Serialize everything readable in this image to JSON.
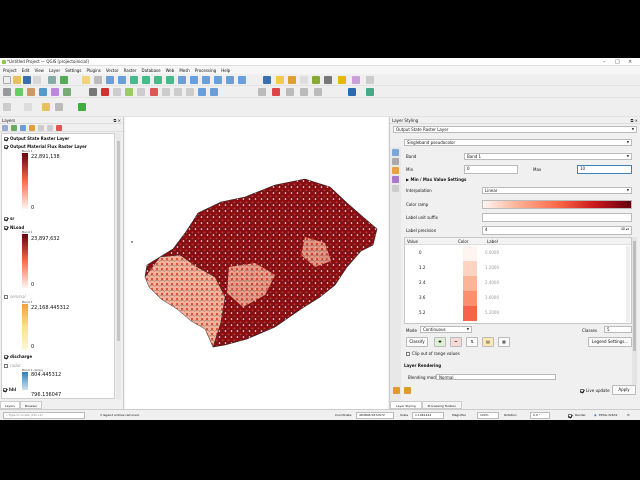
{
  "window": {
    "title": "*Untitled Project — QGIS [projectoinicial]"
  },
  "menu": [
    "Project",
    "Edit",
    "View",
    "Layer",
    "Settings",
    "Plugins",
    "Vector",
    "Raster",
    "Database",
    "Web",
    "Mesh",
    "Processing",
    "Help"
  ],
  "layers_panel": {
    "title": "Layers",
    "layers": [
      {
        "name": "Output State Raster Layer",
        "checked": true,
        "style": "bold"
      },
      {
        "name": "Output Material Flux Raster Layer",
        "checked": true,
        "style": "bold",
        "band": "Band 1",
        "max": "22,891,138",
        "min": "0"
      },
      {
        "name": "sr",
        "checked": true,
        "style": "bold"
      },
      {
        "name": "NLoad",
        "checked": true,
        "style": "bold",
        "band": "Band 1",
        "max": "23,897,632",
        "min": "0"
      },
      {
        "name": "seminal",
        "checked": false,
        "style": "grey",
        "band": "Band 1",
        "max": "22,168.445312",
        "min": "0"
      },
      {
        "name": "discharge",
        "checked": true,
        "style": "bold"
      },
      {
        "name": "radar",
        "checked": false,
        "style": "grey",
        "band": "Band 1 (Gray)",
        "max": "804.445312",
        "min": "796.136047"
      },
      {
        "name": "hhl",
        "checked": true,
        "style": "bold"
      }
    ],
    "tabs": [
      "Layers",
      "Browser"
    ]
  },
  "styling_panel": {
    "title": "Layer Styling",
    "layer_select": "Output State Raster Layer",
    "renderer": "Singleband pseudocolor",
    "band_label": "Band",
    "band_value": "Band 1",
    "min_label": "Min",
    "min_value": "0",
    "max_label": "Max",
    "max_value": "10",
    "minmax_section": "Min / Max Value Settings",
    "interpolation_label": "Interpolation",
    "interpolation_value": "Linear",
    "color_ramp_label": "Color ramp",
    "label_unit_label": "Label unit suffix",
    "label_precision_label": "Label precision",
    "label_precision_value": "4",
    "table_headers": [
      "Value",
      "Color",
      "Label"
    ],
    "rows": [
      {
        "value": "0",
        "color": "#fff5f0",
        "label": "0.0000"
      },
      {
        "value": "1.2",
        "color": "#fdd4c2",
        "label": "1.2000"
      },
      {
        "value": "2.4",
        "color": "#fcb499",
        "label": "2.4000"
      },
      {
        "value": "3.6",
        "color": "#fc8f70",
        "label": "3.6000"
      },
      {
        "value": "5.2",
        "color": "#f7624a",
        "label": "5.2000"
      }
    ],
    "mode_label": "Mode",
    "mode_value": "Continuous",
    "classes_label": "Classes",
    "classes_value": "5",
    "classify_label": "Classify",
    "legend_settings_label": "Legend Settings...",
    "clip_label": "Clip out of range values",
    "layer_rendering_label": "Layer Rendering",
    "blending_label": "Blending mode",
    "blending_value": "Normal",
    "live_update_label": "Live update",
    "apply_label": "Apply",
    "tabs": [
      "Layer Styling",
      "Processing Toolbox"
    ]
  },
  "status_bar": {
    "search_placeholder": "Type to locate (Ctrl+K)",
    "message": "3 legend entries removed.",
    "coordinate_label": "Coordinate",
    "coordinate_value": "484808,5672972",
    "scale_label": "Scale",
    "scale_value": "1:1961444",
    "magnifier_label": "Magnifier",
    "magnifier_value": "100%",
    "rotation_label": "Rotation",
    "rotation_value": "0.0 °",
    "render_label": "Render",
    "crs": "EPSG:32632"
  },
  "colors": {
    "ramp_start": "#fff5f0",
    "ramp_end": "#67000d",
    "qgis_green": "#8dc63f"
  }
}
